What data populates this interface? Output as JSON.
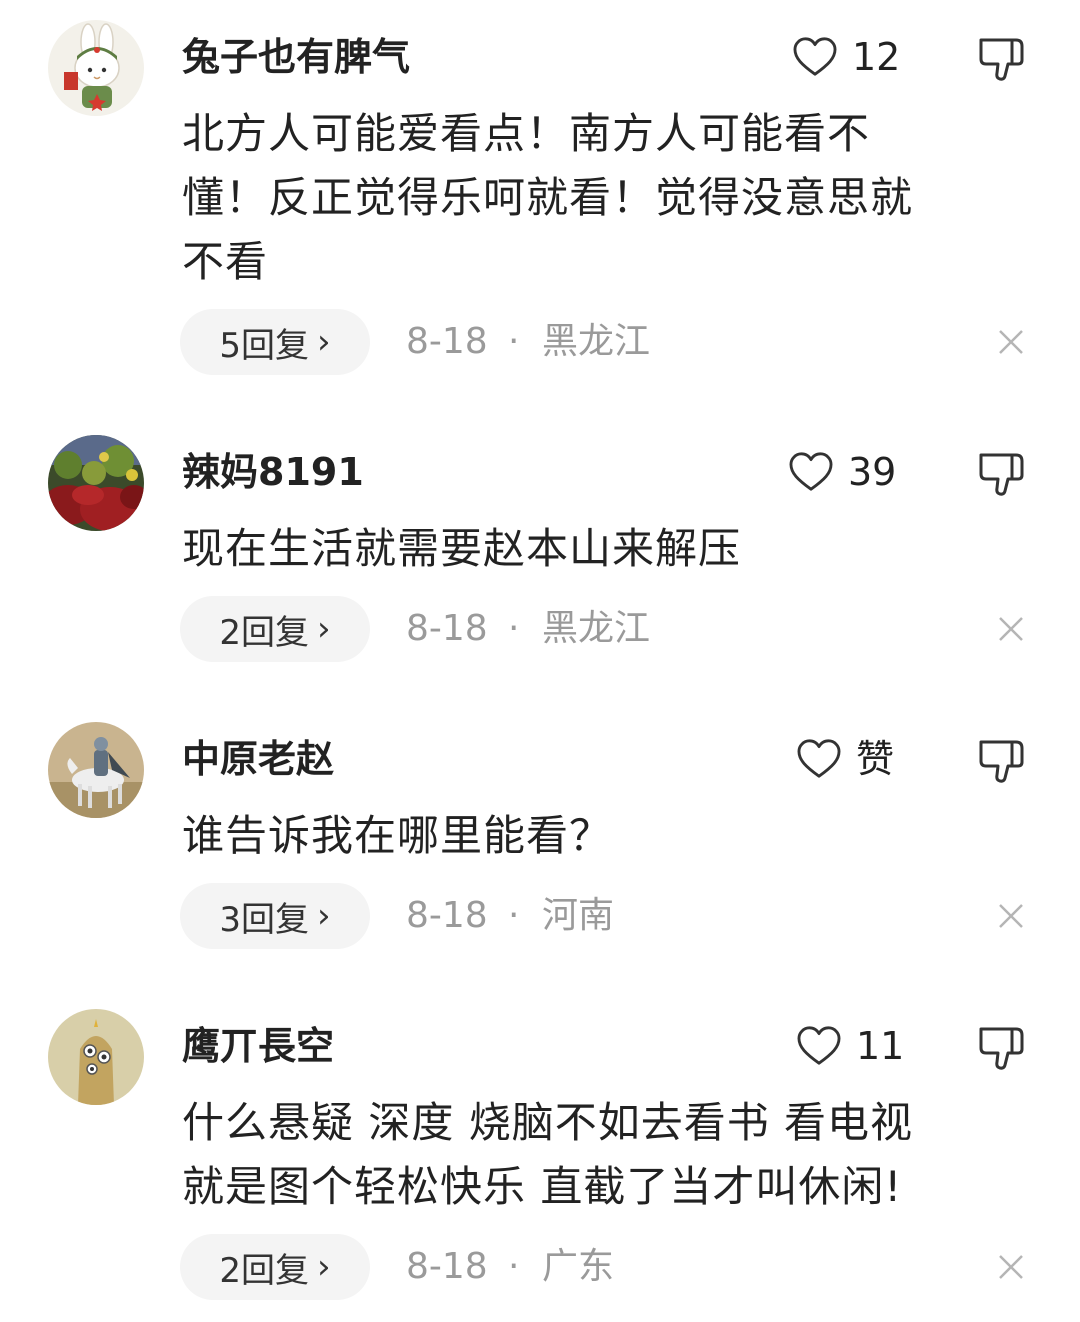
{
  "comments": [
    {
      "username": "兔子也有脾气",
      "likes": "12",
      "text": "北方人可能爱看点！南方人可能看不懂！反正觉得乐呵就看！觉得没意思就不看",
      "lines": [
        "北方人可能爱看点！南方人可能看不",
        "懂！反正觉得乐呵就看！觉得没意思就",
        "不看"
      ],
      "replies": "5回复",
      "date": "8-18",
      "separator": "·",
      "location": "黑龙江"
    },
    {
      "username": "辣妈8191",
      "likes": "39",
      "lines": [
        "现在生活就需要赵本山来解压"
      ],
      "replies": "2回复",
      "date": "8-18",
      "separator": "·",
      "location": "黑龙江"
    },
    {
      "username": "中原老赵",
      "likes": "赞",
      "lines": [
        "谁告诉我在哪里能看？"
      ],
      "replies": "3回复",
      "date": "8-18",
      "separator": "·",
      "location": "河南"
    },
    {
      "username": "鹰丌長空",
      "likes": "11",
      "lines": [
        "什么悬疑 深度 烧脑不如去看书 看电视",
        "就是图个轻松快乐 直截了当才叫休闲!"
      ],
      "replies": "2回复",
      "date": "8-18",
      "separator": "·",
      "location": "广东"
    }
  ],
  "icons": {
    "like": "heart-outline-icon",
    "dislike": "thumbs-down-outline-icon",
    "reply_chevron": "chevron-right-icon",
    "dismiss": "close-icon",
    "chevron_glyph": "›"
  },
  "colors": {
    "text": "#222222",
    "meta": "#9a9a9a",
    "pill_bg": "#f4f4f4",
    "icon": "#333333"
  }
}
